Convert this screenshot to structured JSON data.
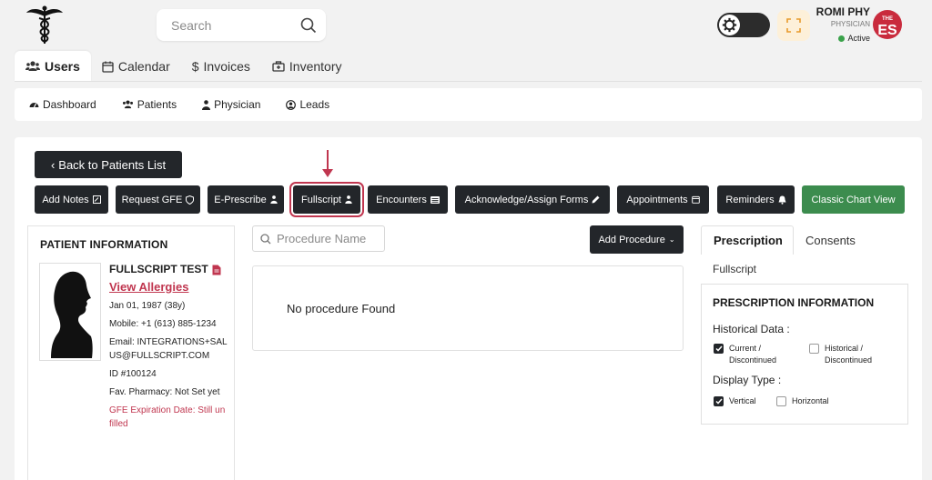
{
  "header": {
    "search_placeholder": "Search",
    "user": {
      "name": "ROMI PHY",
      "role": "PHYSICIAN",
      "status": "Active"
    },
    "brand": {
      "line1": "THE",
      "line2": "ES"
    }
  },
  "main_tabs": [
    {
      "label": "Users",
      "icon": "users-icon",
      "active": true
    },
    {
      "label": "Calendar",
      "icon": "calendar-icon"
    },
    {
      "label": "Invoices",
      "icon": "dollar-icon"
    },
    {
      "label": "Inventory",
      "icon": "inventory-icon"
    }
  ],
  "sub_nav": [
    {
      "label": "Dashboard",
      "icon": "dashboard-icon"
    },
    {
      "label": "Patients",
      "icon": "users-icon"
    },
    {
      "label": "Physician",
      "icon": "physician-icon"
    },
    {
      "label": "Leads",
      "icon": "lead-icon"
    }
  ],
  "back_button": "Back to Patients List",
  "actions": [
    {
      "label": "Add Notes"
    },
    {
      "label": "Request GFE"
    },
    {
      "label": "E-Prescribe"
    },
    {
      "label": "Fullscript"
    },
    {
      "label": "Encounters"
    },
    {
      "label": "Acknowledge/Assign Forms"
    },
    {
      "label": "Appointments"
    },
    {
      "label": "Reminders"
    },
    {
      "label": "Classic Chart View"
    }
  ],
  "patient": {
    "section_title": "PATIENT INFORMATION",
    "name": "FULLSCRIPT TEST",
    "allergies_link": "View Allergies",
    "dob": "Jan 01, 1987 (38y)",
    "mobile": "Mobile: +1 (613) 885-1234",
    "email": "Email: INTEGRATIONS+SALUS@FULLSCRIPT.COM",
    "id": "ID #100124",
    "pharmacy": "Fav. Pharmacy: Not Set yet",
    "gfe": "GFE Expiration Date: Still unfilled"
  },
  "procedure": {
    "search_placeholder": "Procedure Name",
    "add_button": "Add Procedure",
    "empty_text": "No procedure Found"
  },
  "right_panel": {
    "tabs": [
      "Prescription",
      "Consents"
    ],
    "sub_tab": "Fullscript",
    "card_title": "PRESCRIPTION INFORMATION",
    "historical_label": "Historical Data :",
    "historical_options": [
      {
        "label": "Current / Discontinued",
        "checked": true
      },
      {
        "label": "Historical / Discontinued",
        "checked": false
      }
    ],
    "display_label": "Display Type :",
    "display_options": [
      {
        "label": "Vertical",
        "checked": true
      },
      {
        "label": "Horizontal",
        "checked": false
      }
    ]
  }
}
